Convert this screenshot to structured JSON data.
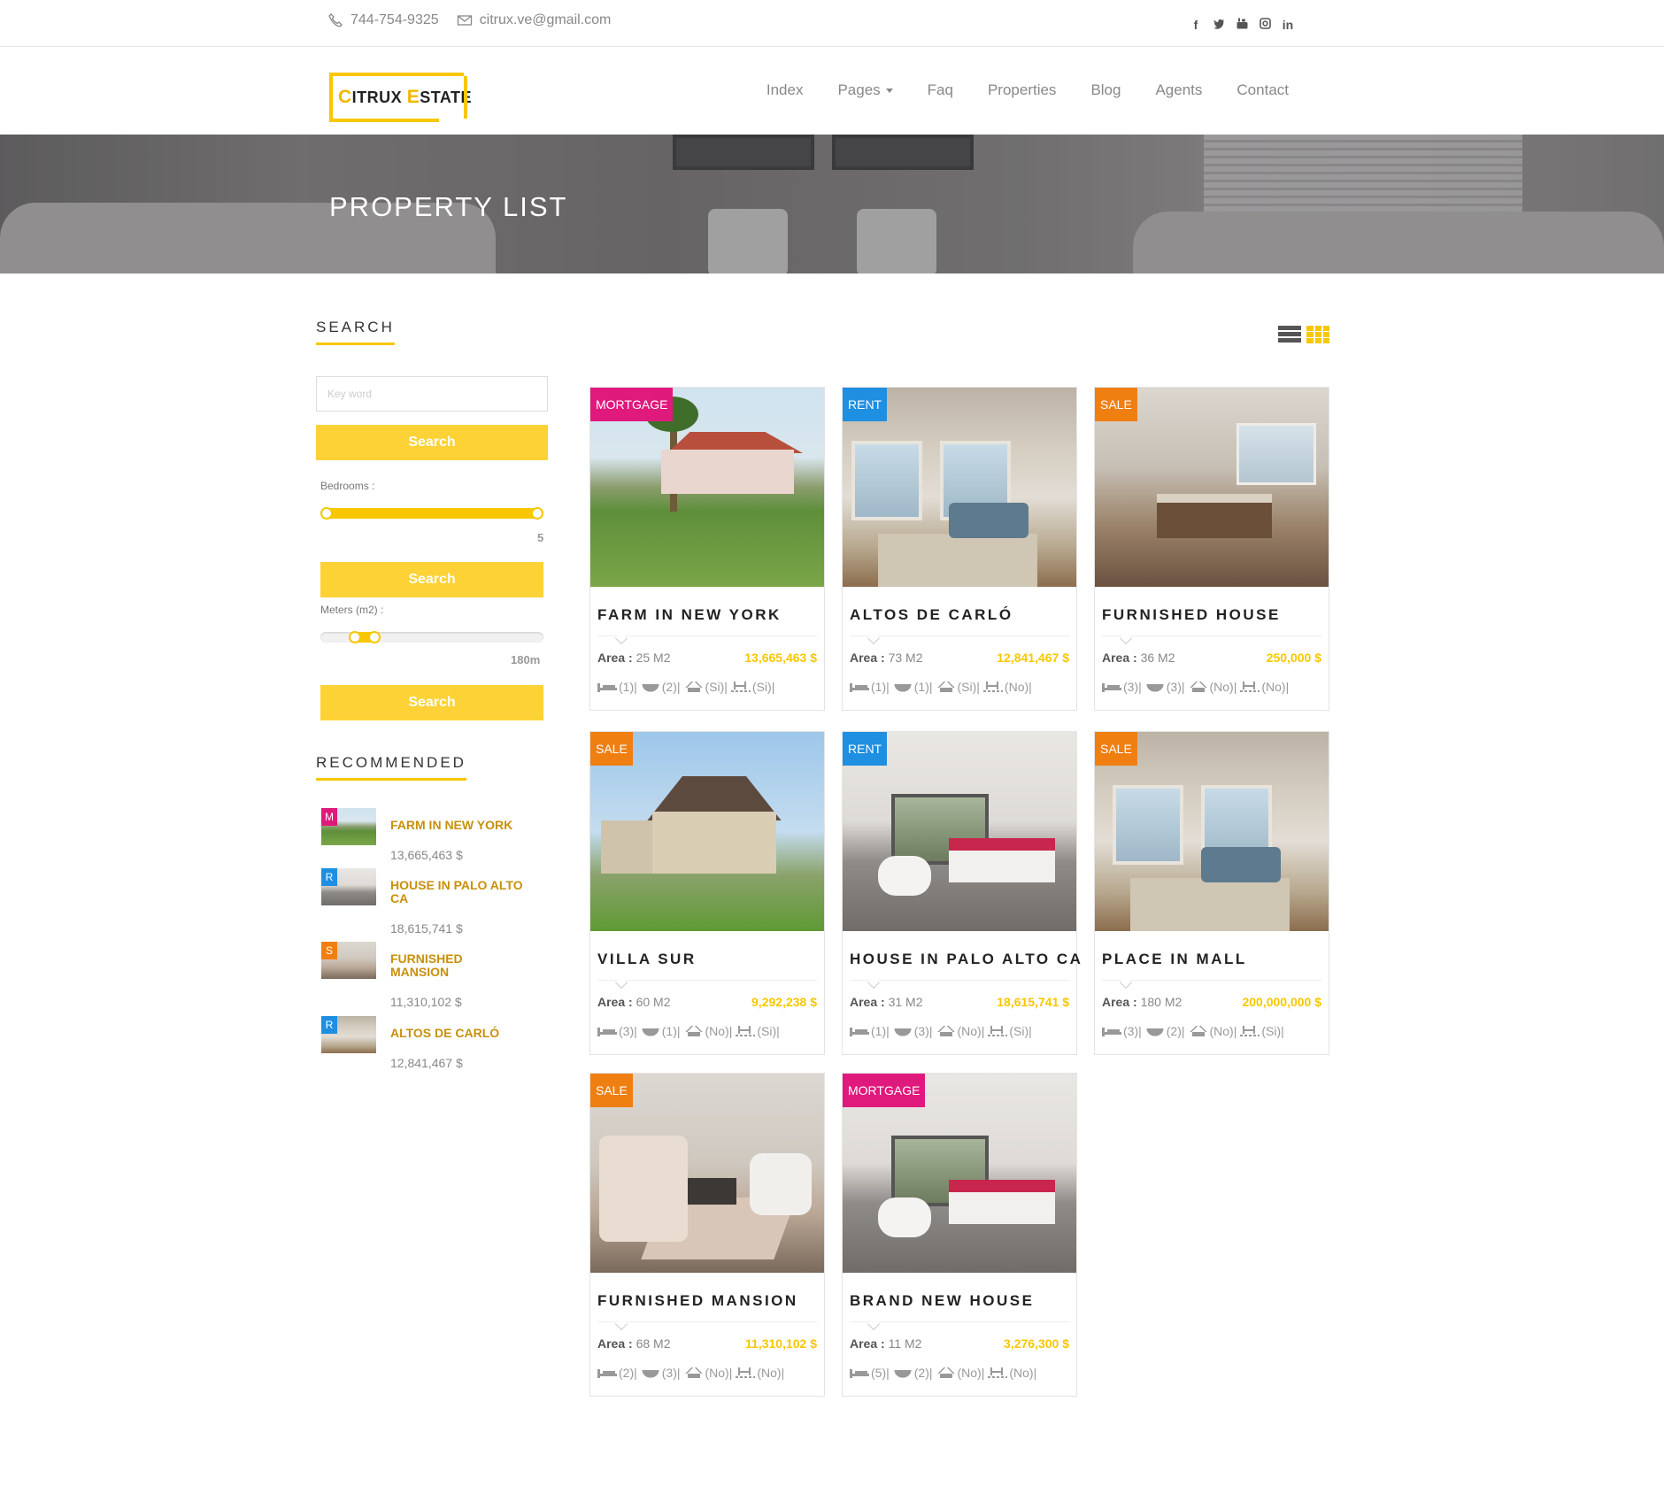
{
  "topbar": {
    "phone": "744-754-9325",
    "email": "citrux.ve@gmail.com",
    "social": [
      "f",
      "t",
      "yt",
      "ig",
      "in"
    ]
  },
  "brand": {
    "c": "C",
    "itrux": "ITRUX ",
    "e": "E",
    "state": "STATE"
  },
  "menu": [
    {
      "label": "Index"
    },
    {
      "label": "Pages"
    },
    {
      "label": "Faq"
    },
    {
      "label": "Properties"
    },
    {
      "label": "Blog"
    },
    {
      "label": "Agents"
    },
    {
      "label": "Contact"
    }
  ],
  "hero": {
    "title": "PROPERTY LIST"
  },
  "sidebar": {
    "search_title": "SEARCH",
    "keyword_placeholder": "Key word",
    "search_label": "Search",
    "bedrooms_label": "Bedrooms :",
    "bedrooms_value": "5",
    "meters_label": "Meters (m2) :",
    "meters_value": "180m",
    "recommended_title": "RECOMMENDED",
    "recommended": [
      {
        "tag": "M",
        "name": "FARM IN NEW YORK",
        "price": "13,665,463 $"
      },
      {
        "tag": "R",
        "name": "HOUSE IN PALO ALTO CA",
        "price": "18,615,741 $"
      },
      {
        "tag": "S",
        "name": "FURNISHED MANSION",
        "price": "11,310,102 $"
      },
      {
        "tag": "R",
        "name": "ALTOS DE CARLÓ",
        "price": "12,841,467 $"
      }
    ]
  },
  "area_label": "Area :",
  "properties": [
    {
      "badge": "MORTGAGE",
      "title": "FARM IN NEW YORK",
      "area": "25 M2",
      "price": "13,665,463 $",
      "beds": "(1)|",
      "baths": "(2)|",
      "garage": "(Si)|",
      "pool": "(Si)|"
    },
    {
      "badge": "RENT",
      "title": "ALTOS DE CARLÓ",
      "area": "73 M2",
      "price": "12,841,467 $",
      "beds": "(1)|",
      "baths": "(1)|",
      "garage": "(Si)|",
      "pool": "(No)|"
    },
    {
      "badge": "SALE",
      "title": "FURNISHED HOUSE",
      "area": "36 M2",
      "price": "250,000 $",
      "beds": "(3)|",
      "baths": "(3)|",
      "garage": "(No)|",
      "pool": "(No)|"
    },
    {
      "badge": "SALE",
      "title": "VILLA SUR",
      "area": "60 M2",
      "price": "9,292,238 $",
      "beds": "(3)|",
      "baths": "(1)|",
      "garage": "(No)|",
      "pool": "(Si)|"
    },
    {
      "badge": "RENT",
      "title": "HOUSE IN PALO ALTO CA",
      "area": "31 M2",
      "price": "18,615,741 $",
      "beds": "(1)|",
      "baths": "(3)|",
      "garage": "(No)|",
      "pool": "(Si)|"
    },
    {
      "badge": "SALE",
      "title": "PLACE IN MALL",
      "area": "180 M2",
      "price": "200,000,000 $",
      "beds": "(3)|",
      "baths": "(2)|",
      "garage": "(No)|",
      "pool": "(Si)|"
    },
    {
      "badge": "SALE",
      "title": "FURNISHED MANSION",
      "area": "68 M2",
      "price": "11,310,102 $",
      "beds": "(2)|",
      "baths": "(3)|",
      "garage": "(No)|",
      "pool": "(No)|"
    },
    {
      "badge": "MORTGAGE",
      "title": "BRAND NEW HOUSE",
      "area": "11 M2",
      "price": "3,276,300 $",
      "beds": "(5)|",
      "baths": "(2)|",
      "garage": "(No)|",
      "pool": "(No)|"
    }
  ],
  "colors": {
    "accent": "#f8c700",
    "button": "#fdd236",
    "mortgage": "#e0197d",
    "rent": "#1e8fe1",
    "sale": "#f07f12"
  }
}
